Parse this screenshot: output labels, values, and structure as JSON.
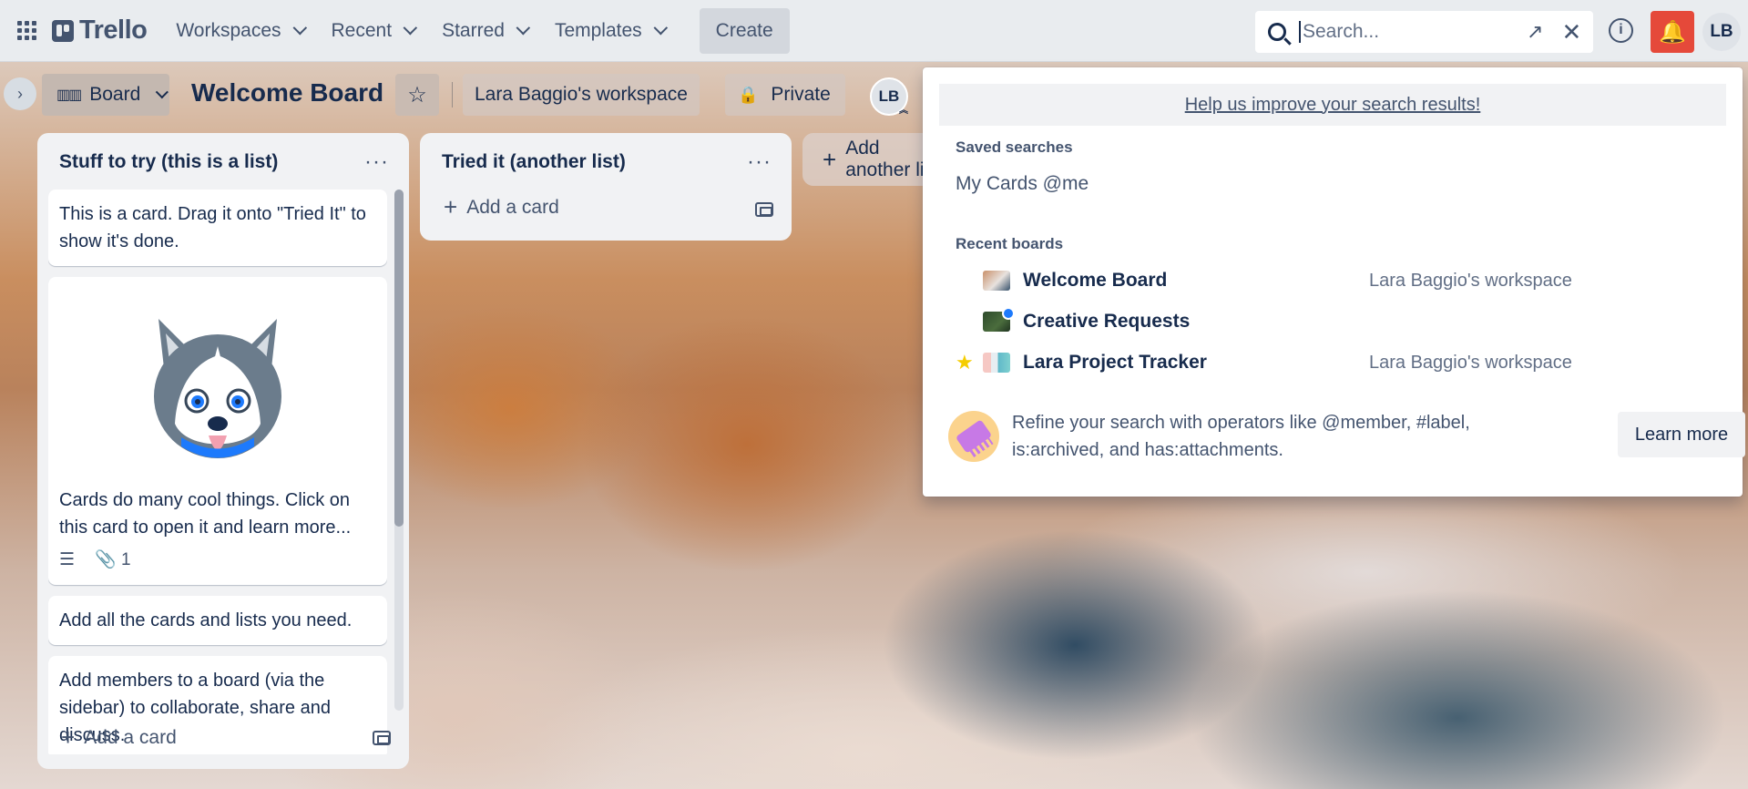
{
  "header": {
    "logo": "Trello",
    "nav": [
      "Workspaces",
      "Recent",
      "Starred",
      "Templates"
    ],
    "create": "Create",
    "search_placeholder": "Search...",
    "avatar_initials": "LB"
  },
  "board": {
    "view_label": "Board",
    "title": "Welcome Board",
    "workspace": "Lara Baggio's workspace",
    "visibility": "Private",
    "member_initials": "LB"
  },
  "lists": [
    {
      "title": "Stuff to try (this is a list)",
      "cards": [
        "This is a card. Drag it onto \"Tried It\" to show it's done.",
        "Cards do many cool things. Click on this card to open it and learn more...",
        "Add all the cards and lists you need.",
        "Add members to a board (via the sidebar) to collaborate, share and discuss."
      ],
      "attachment_count": "1",
      "add_card": "Add a card"
    },
    {
      "title": "Tried it (another list)",
      "add_card": "Add a card"
    }
  ],
  "add_list": "Add another list",
  "search_popover": {
    "feedback_link": "Help us improve your search results!",
    "saved_searches_label": "Saved searches",
    "saved_search": "My Cards @me",
    "recent_boards_label": "Recent boards",
    "recent_boards": [
      {
        "name": "Welcome Board",
        "workspace": "Lara Baggio's workspace",
        "starred": false
      },
      {
        "name": "Creative Requests",
        "workspace": "",
        "starred": false
      },
      {
        "name": "Lara Project Tracker",
        "workspace": "Lara Baggio's workspace",
        "starred": true
      }
    ],
    "tip": "Refine your search with operators like @member, #label, is:archived, and has:attachments.",
    "learn_more": "Learn more"
  },
  "colors": {
    "notification": "#e5493a",
    "star": "#f5cd00",
    "unread_dot": "#1d7afc"
  }
}
